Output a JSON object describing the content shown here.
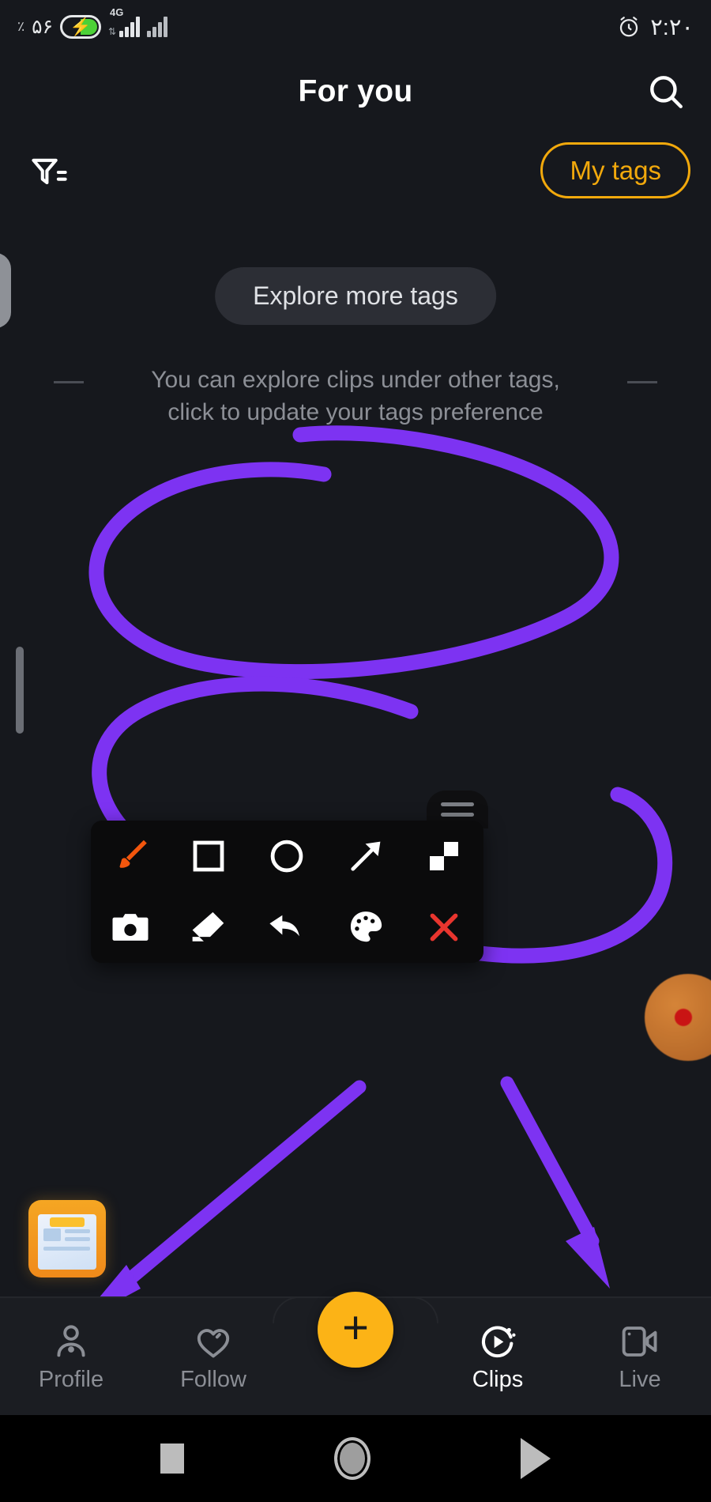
{
  "status_bar": {
    "battery_percent_symbol": "٪",
    "battery_level": "۵۶",
    "battery_icon": "battery-charging-icon",
    "network_type": "4G",
    "signal_icon": "signal-bars-icon",
    "alarm_icon": "alarm-clock-icon",
    "time": "۲:۲۰"
  },
  "header": {
    "title": "For you",
    "search_icon": "search-icon"
  },
  "filter_row": {
    "filter_icon": "filter-icon",
    "my_tags_label": "My tags",
    "my_tags_color": "#f2a90c"
  },
  "explore": {
    "pill_label": "Explore more tags",
    "hint_line1": "You can explore clips under other tags,",
    "hint_line2": "click to update your tags preference"
  },
  "annotation": {
    "ink_color": "#7d33f2",
    "shapes": [
      "circle-scribble-top",
      "circle-scribble-bottom",
      "arrow-to-profile",
      "arrow-to-live"
    ]
  },
  "toolbar": {
    "handle_icon": "drag-handle-icon",
    "tools": [
      {
        "name": "brush-tool-icon",
        "label": "Brush",
        "active": true,
        "color": "#f2560d"
      },
      {
        "name": "rectangle-tool-icon",
        "label": "Rectangle",
        "active": false,
        "color": "#ffffff"
      },
      {
        "name": "ellipse-tool-icon",
        "label": "Ellipse",
        "active": false,
        "color": "#ffffff"
      },
      {
        "name": "arrow-tool-icon",
        "label": "Arrow",
        "active": false,
        "color": "#ffffff"
      },
      {
        "name": "mosaic-tool-icon",
        "label": "Mosaic",
        "active": false,
        "color": "#ffffff"
      },
      {
        "name": "camera-tool-icon",
        "label": "Screenshot",
        "active": false,
        "color": "#ffffff"
      },
      {
        "name": "eraser-tool-icon",
        "label": "Eraser",
        "active": false,
        "color": "#ffffff"
      },
      {
        "name": "undo-tool-icon",
        "label": "Undo",
        "active": false,
        "color": "#ffffff"
      },
      {
        "name": "palette-tool-icon",
        "label": "Color",
        "active": false,
        "color": "#ffffff"
      },
      {
        "name": "close-tool-icon",
        "label": "Close",
        "active": false,
        "color": "#e8352e"
      }
    ]
  },
  "floating": {
    "clipboard_icon": "clipboard-note-icon",
    "orange_widget_icon": "floating-bubble-icon",
    "edge_swipe_icon": "edge-swipe-handle-icon",
    "side_scroll_icon": "scroll-handle-icon"
  },
  "bottom_nav": {
    "items": [
      {
        "label": "Profile",
        "icon": "profile-icon",
        "active": false
      },
      {
        "label": "Follow",
        "icon": "heart-icon",
        "active": false
      },
      {
        "label": "Clips",
        "icon": "clips-icon",
        "active": true
      },
      {
        "label": "Live",
        "icon": "live-icon",
        "active": false
      }
    ],
    "fab_label": "+",
    "fab_color": "#fcb316"
  },
  "android_nav": {
    "recents_icon": "recents-square-icon",
    "home_icon": "home-circle-icon",
    "back_icon": "back-triangle-icon"
  }
}
